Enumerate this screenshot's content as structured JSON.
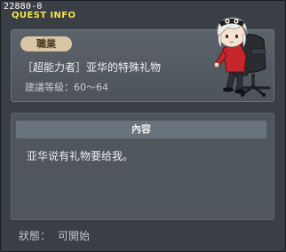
{
  "window": {
    "quest_id": "22880-0",
    "title": "QUEST INFO"
  },
  "job": {
    "badge_label": "職業"
  },
  "quest": {
    "name": "［超能力者］亚华的特殊礼物",
    "required_level": "建議等級：60～64"
  },
  "content": {
    "header": "內容",
    "text": "亚华说有礼物要给我。"
  },
  "status": {
    "label": "狀態：",
    "value": "可開始"
  },
  "colors": {
    "title": "#f2e44a",
    "badge_bg": "#d9c6a4",
    "panel_bg": "#50565e",
    "header_bg": "#69737d"
  }
}
